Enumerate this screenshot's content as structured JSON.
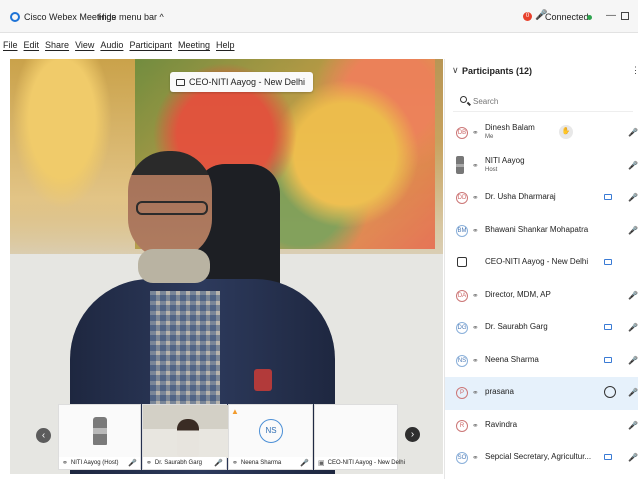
{
  "window": {
    "app_title": "Cisco Webex Meetings",
    "hide_menu": "Hide menu bar ^",
    "notification_count": "0",
    "connection_status": "Connected",
    "status_color": "#2ea44f"
  },
  "menu": {
    "items": [
      "File",
      "Edit",
      "Share",
      "View",
      "Audio",
      "Participant",
      "Meeting",
      "Help"
    ]
  },
  "video": {
    "active_speaker_label": "CEO-NITI Aayog - New Delhi"
  },
  "thumbnails": [
    {
      "name": "NITI Aayog (Host)"
    },
    {
      "name": "Dr. Saurabh Garg"
    },
    {
      "name": "Neena Sharma",
      "initials": "NS"
    },
    {
      "name": "CEO-NITI Aayog - New Delhi"
    }
  ],
  "participants": {
    "title": "Participants (12)",
    "search_placeholder": "Search",
    "list": [
      {
        "initials": "DB",
        "name": "Dinesh Balam",
        "role": "Me"
      },
      {
        "initials": "",
        "name": "NITI Aayog",
        "role": "Host"
      },
      {
        "initials": "DD",
        "name": "Dr. Usha Dharmaraj",
        "role": ""
      },
      {
        "initials": "BM",
        "name": "Bhawani Shankar Mohapatra",
        "role": ""
      },
      {
        "initials": "",
        "name": "CEO-NITI Aayog - New Delhi",
        "role": ""
      },
      {
        "initials": "DA",
        "name": "Director, MDM, AP",
        "role": ""
      },
      {
        "initials": "DG",
        "name": "Dr. Saurabh Garg",
        "role": ""
      },
      {
        "initials": "NS",
        "name": "Neena Sharma",
        "role": ""
      },
      {
        "initials": "P",
        "name": "prasana",
        "role": ""
      },
      {
        "initials": "R",
        "name": "Ravindra",
        "role": ""
      },
      {
        "initials": "SO",
        "name": "Sepcial Secretary, Agricultur...",
        "role": ""
      }
    ]
  }
}
